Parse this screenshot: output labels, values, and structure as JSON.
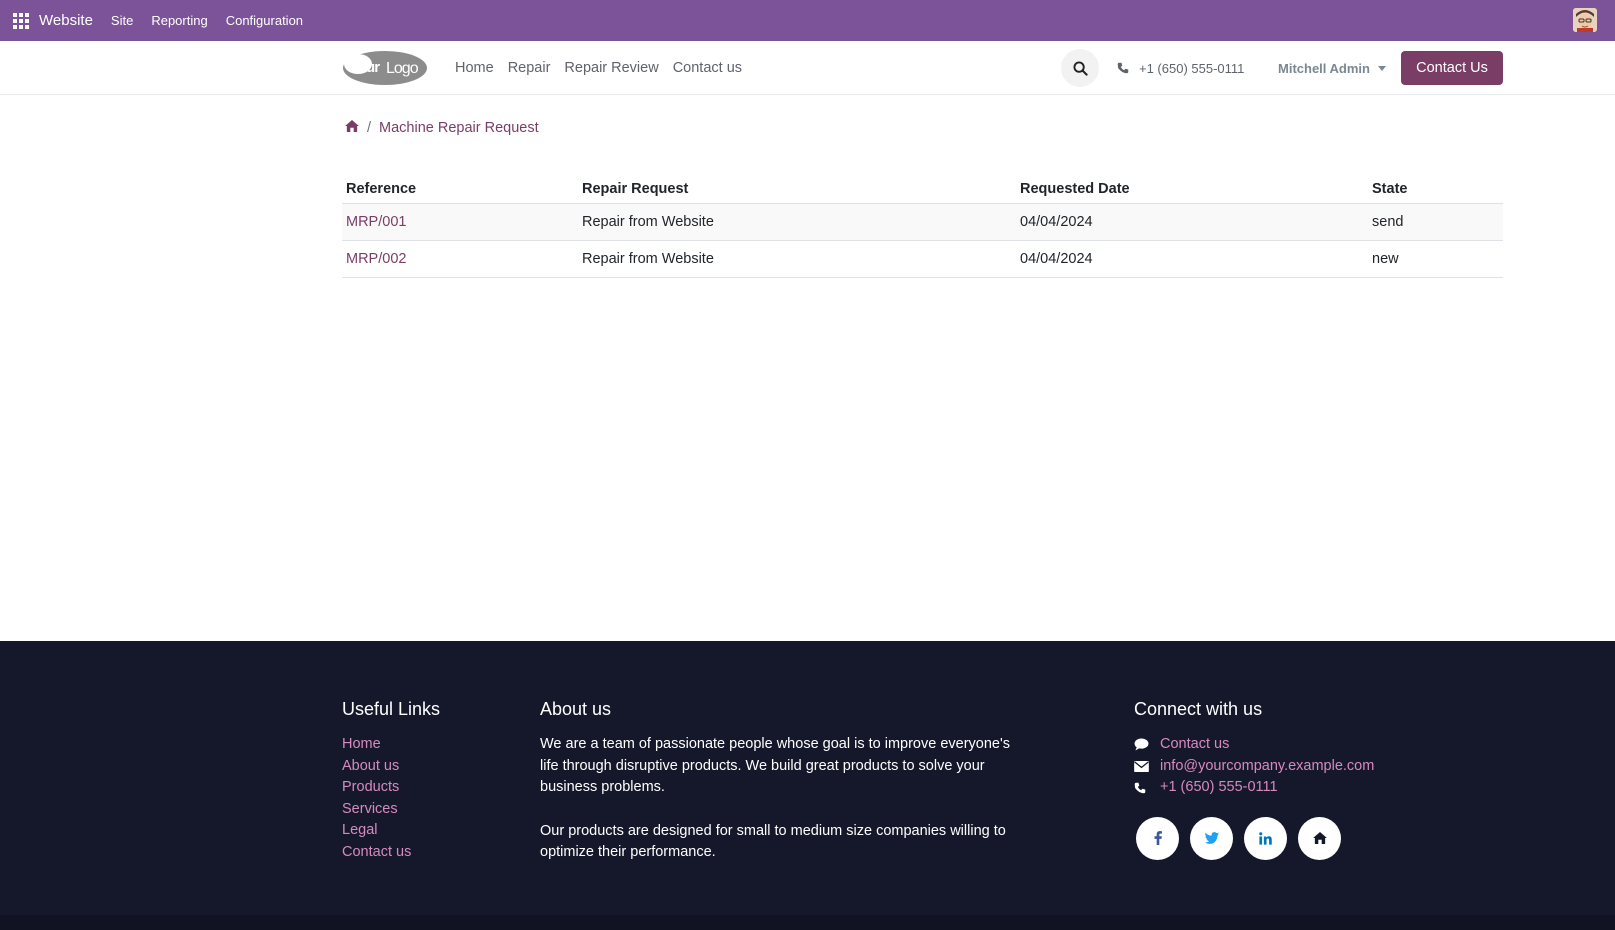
{
  "topbar": {
    "app_name": "Website",
    "menus": [
      "Site",
      "Reporting",
      "Configuration"
    ]
  },
  "header": {
    "logo_text": "YourLogo",
    "nav": [
      "Home",
      "Repair",
      "Repair Review",
      "Contact us"
    ],
    "phone": "+1 (650) 555-0111",
    "user": "Mitchell Admin",
    "contact_button": "Contact Us"
  },
  "breadcrumb": {
    "current": "Machine Repair Request",
    "separator": "/"
  },
  "table": {
    "columns": [
      "Reference",
      "Repair Request",
      "Requested Date",
      "State"
    ],
    "rows": [
      {
        "reference": "MRP/001",
        "request": "Repair from Website",
        "date": "04/04/2024",
        "state": "send"
      },
      {
        "reference": "MRP/002",
        "request": "Repair from Website",
        "date": "04/04/2024",
        "state": "new"
      }
    ]
  },
  "footer": {
    "useful_links": {
      "title": "Useful Links",
      "links": [
        "Home",
        "About us",
        "Products",
        "Services",
        "Legal",
        "Contact us"
      ]
    },
    "about": {
      "title": "About us",
      "paragraphs": [
        "We are a team of passionate people whose goal is to improve everyone's life through disruptive products. We build great products to solve your business problems.",
        "Our products are designed for small to medium size companies willing to optimize their performance."
      ]
    },
    "connect": {
      "title": "Connect with us",
      "contact": "Contact us",
      "email": "info@yourcompany.example.com",
      "phone": "+1 (650) 555-0111",
      "socials": [
        "facebook-icon",
        "twitter-icon",
        "linkedin-icon",
        "home-icon"
      ]
    }
  },
  "colors": {
    "topbar": "#7c5299",
    "primary": "#7a3e66",
    "footer_bg": "#15182a",
    "footer_link": "#d58ac0"
  }
}
